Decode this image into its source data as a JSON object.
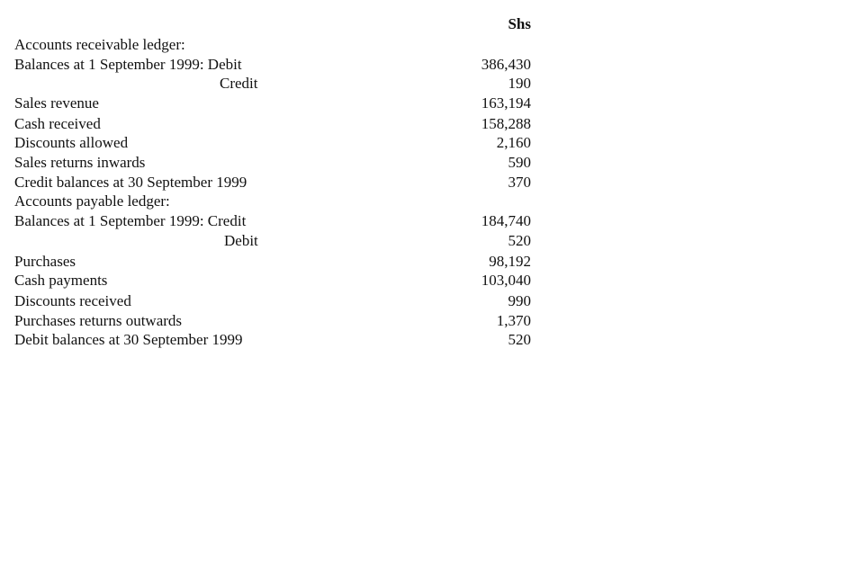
{
  "column_header": "Shs",
  "receivable": {
    "title": "Accounts receivable ledger:",
    "balances_label": "Balances at 1 September 1999: Debit",
    "balances_sub_label": "Credit",
    "balances_value": "386,430",
    "balances_sub_value": "190",
    "items": [
      {
        "label": "Sales revenue",
        "value": "163,194"
      },
      {
        "label": "Cash received",
        "value": "158,288"
      },
      {
        "label": "Discounts allowed",
        "value": "2,160"
      },
      {
        "label": "Sales returns inwards",
        "value": "590"
      },
      {
        "label": "Credit balances at 30 September 1999",
        "value": "370"
      }
    ]
  },
  "payable": {
    "title": "Accounts payable ledger:",
    "balances_label": "Balances at 1 September 1999: Credit",
    "balances_sub_label": "Debit",
    "balances_value": "184,740",
    "balances_sub_value": "520",
    "items": [
      {
        "label": "Purchases",
        "value": "98,192"
      },
      {
        "label": "Cash payments",
        "value": "103,040"
      },
      {
        "label": "Discounts received",
        "value": "990"
      },
      {
        "label": "Purchases returns outwards",
        "value": "1,370"
      },
      {
        "label": "Debit balances at 30 September 1999",
        "value": "520"
      }
    ]
  }
}
